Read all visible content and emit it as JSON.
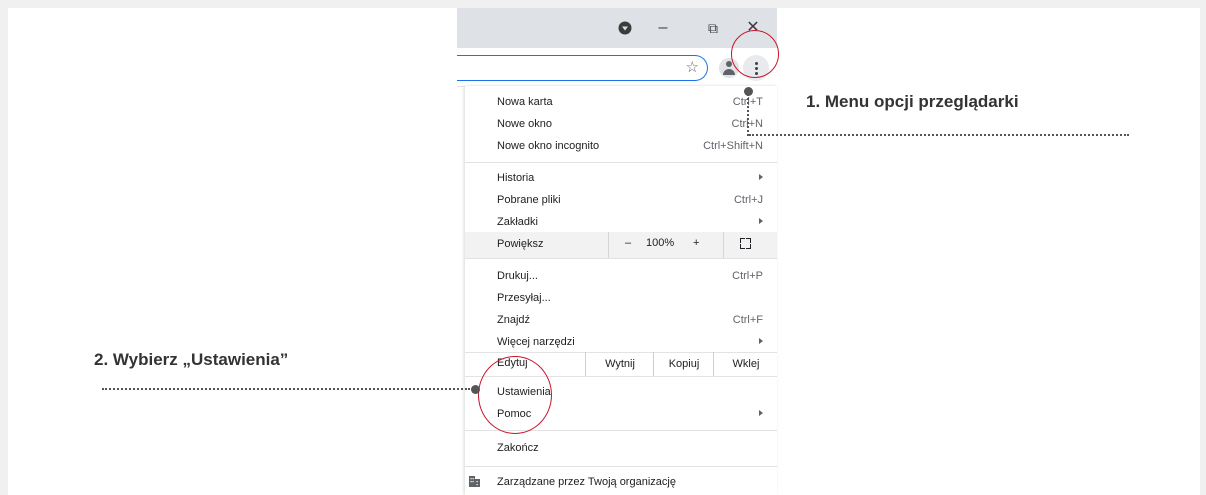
{
  "window_controls": {
    "minimize": "–",
    "restore": "⧉",
    "close": "✕"
  },
  "toolbar": {
    "bookmark_icon": "star-outline-icon"
  },
  "menu": {
    "new_tab": {
      "label": "Nowa karta",
      "shortcut": "Ctrl+T"
    },
    "new_window": {
      "label": "Nowe okno",
      "shortcut": "Ctrl+N"
    },
    "incognito": {
      "label": "Nowe okno incognito",
      "shortcut": "Ctrl+Shift+N"
    },
    "history": {
      "label": "Historia"
    },
    "downloads": {
      "label": "Pobrane pliki",
      "shortcut": "Ctrl+J"
    },
    "bookmarks": {
      "label": "Zakładki"
    },
    "zoom": {
      "label": "Powiększ",
      "minus": "–",
      "value": "100%",
      "plus": "+"
    },
    "print": {
      "label": "Drukuj...",
      "shortcut": "Ctrl+P"
    },
    "cast": {
      "label": "Przesyłaj..."
    },
    "find": {
      "label": "Znajdź",
      "shortcut": "Ctrl+F"
    },
    "more_tools": {
      "label": "Więcej narzędzi"
    },
    "edit": {
      "label": "Edytuj",
      "cut": "Wytnij",
      "copy": "Kopiuj",
      "paste": "Wklej"
    },
    "settings": {
      "label": "Ustawienia"
    },
    "help": {
      "label": "Pomoc"
    },
    "exit": {
      "label": "Zakończ"
    },
    "managed": {
      "label": "Zarządzane przez Twoją organizację"
    }
  },
  "annotations": {
    "step1": "1. Menu opcji przeglądarki",
    "step2": "2. Wybierz „Ustawienia”",
    "highlight_color": "#c9142a"
  }
}
